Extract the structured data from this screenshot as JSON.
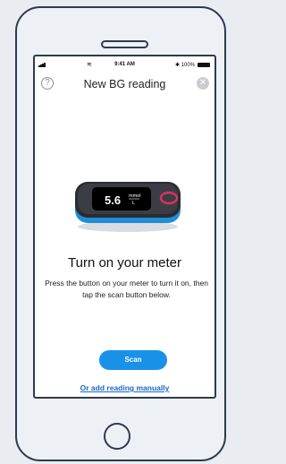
{
  "status_bar": {
    "time": "9:41 AM",
    "battery": "100%",
    "wifi_icon": "wifi-icon",
    "signal_icon": "signal-bars-icon"
  },
  "header": {
    "title": "New BG reading",
    "help_icon": "?",
    "close_icon": "✕"
  },
  "meter": {
    "reading": "5.6",
    "unit_top": "mmol",
    "unit_bottom": "L"
  },
  "main": {
    "heading": "Turn on your meter",
    "instructions": "Press the button on your meter to turn it on, then tap the scan button below."
  },
  "actions": {
    "scan_label": "Scan",
    "manual_link": "Or add reading manually"
  },
  "colors": {
    "accent": "#1a91e8",
    "link": "#1c66c4",
    "device_frame": "#2f3a4d",
    "meter_ring": "#e0305e"
  }
}
